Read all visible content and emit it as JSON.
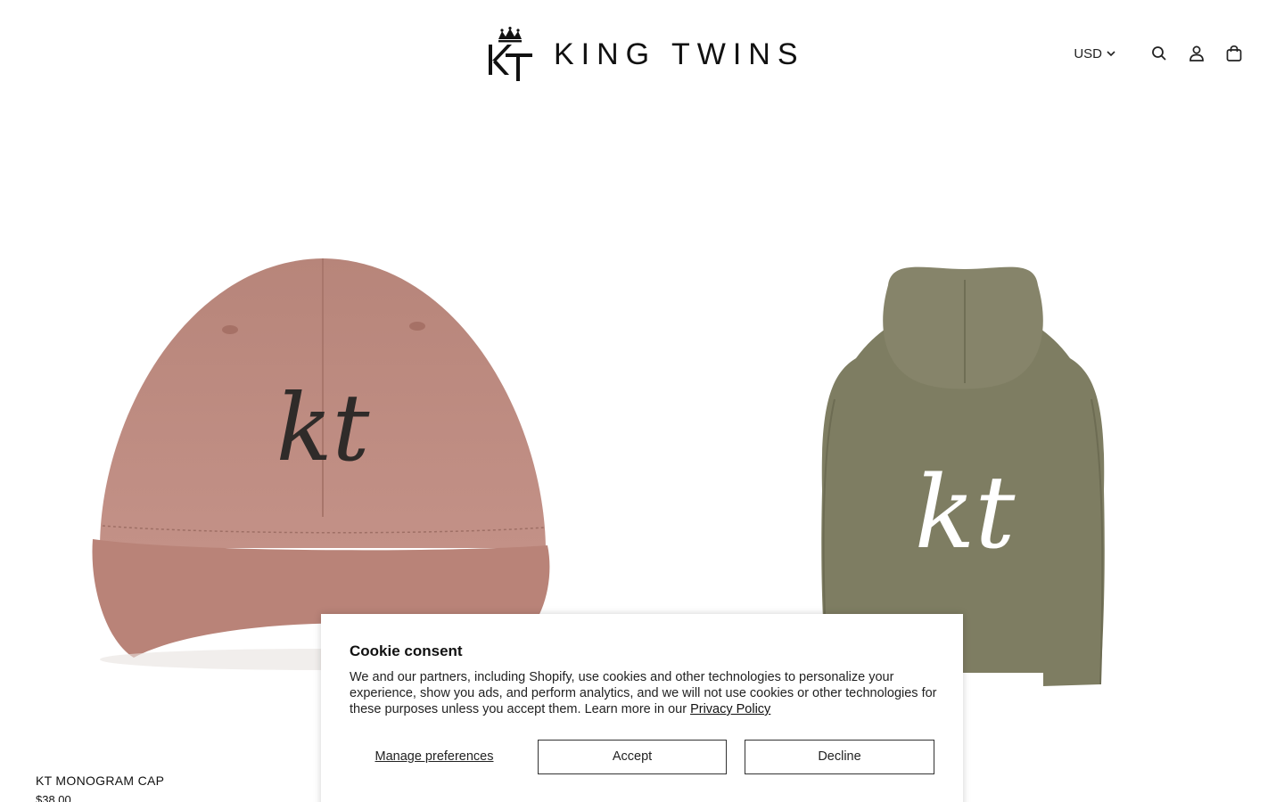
{
  "brand": {
    "name": "KING TWINS",
    "monogram": "KT"
  },
  "header": {
    "currency": "USD",
    "icons": [
      "search-icon",
      "account-icon",
      "cart-icon"
    ]
  },
  "products": [
    {
      "title": "KT MONOGRAM CAP",
      "price": "$38.00",
      "image_mark": "kt",
      "color": "#c0887d"
    },
    {
      "title": "",
      "price": "",
      "image_mark": "kt",
      "color": "#7f7f63"
    }
  ],
  "cookie_consent": {
    "title": "Cookie consent",
    "body": "We and our partners, including Shopify, use cookies and other technologies to personalize your experience, show you ads, and perform analytics, and we will not use cookies or other technologies for these purposes unless you accept them. Learn more in our ",
    "privacy_link": "Privacy Policy",
    "manage_label": "Manage preferences",
    "accept_label": "Accept",
    "decline_label": "Decline"
  }
}
